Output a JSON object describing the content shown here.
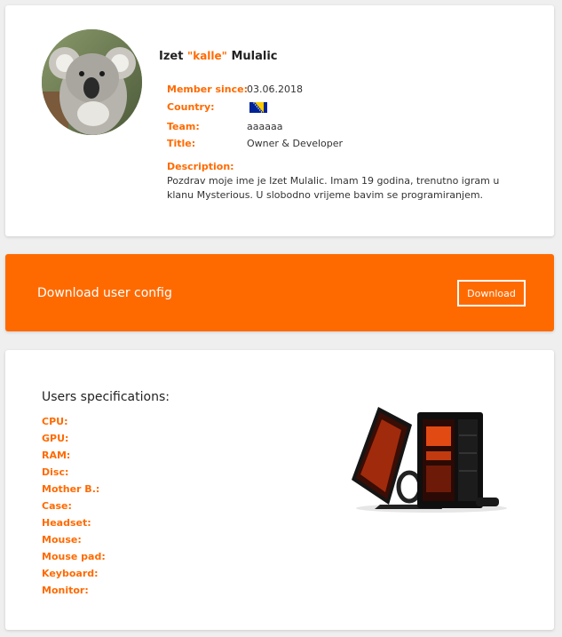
{
  "profile": {
    "first_name": "Izet",
    "nickname": "\"kalle\"",
    "last_name": "Mulalic",
    "avatar_icon": "koala-avatar",
    "fields": {
      "member_since_label": "Member since:",
      "member_since_value": "03.06.2018",
      "country_label": "Country:",
      "country_flag": "bosnia-herzegovina-flag",
      "team_label": "Team:",
      "team_value": "aaaaaa",
      "title_label": "Title:",
      "title_value": "Owner & Developer"
    },
    "description_label": "Description:",
    "description_text": "Pozdrav moje ime je Izet Mulalic. Imam 19 godina, trenutno igram u klanu Mysterious. U slobodno vrijeme bavim se programiranjem."
  },
  "download": {
    "title": "Download user config",
    "button_label": "Download"
  },
  "specs": {
    "title": "Users specifications:",
    "items": [
      {
        "label": "CPU:"
      },
      {
        "label": "GPU:"
      },
      {
        "label": "RAM:"
      },
      {
        "label": "Disc:"
      },
      {
        "label": "Mother B.:"
      },
      {
        "label": "Case:"
      },
      {
        "label": "Headset:"
      },
      {
        "label": "Mouse:"
      },
      {
        "label": "Mouse pad:"
      },
      {
        "label": "Keyboard:"
      },
      {
        "label": "Monitor:"
      }
    ],
    "image_icon": "gaming-pc-image"
  },
  "colors": {
    "accent": "#ff6a00",
    "background": "#efefef",
    "card": "#ffffff"
  }
}
